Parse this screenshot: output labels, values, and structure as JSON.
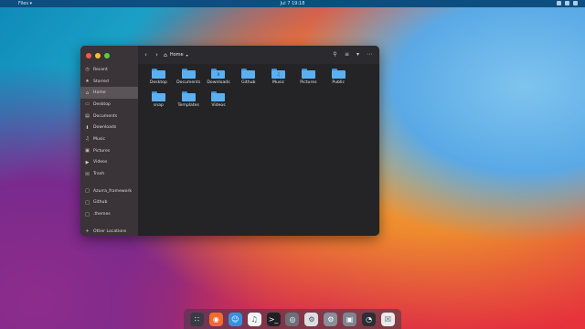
{
  "topbar": {
    "app_menu": "Files ▾",
    "clock": "Jul 7  19:18"
  },
  "window": {
    "sidebar": {
      "items": [
        {
          "label": "Recent",
          "icon": "clock-icon",
          "glyph": "◷"
        },
        {
          "label": "Starred",
          "icon": "star-icon",
          "glyph": "★"
        },
        {
          "label": "Home",
          "icon": "home-icon",
          "glyph": "⌂",
          "active": true
        },
        {
          "label": "Desktop",
          "icon": "desktop-icon",
          "glyph": "▭"
        },
        {
          "label": "Documents",
          "icon": "document-icon",
          "glyph": "▤"
        },
        {
          "label": "Downloads",
          "icon": "download-icon",
          "glyph": "⬇"
        },
        {
          "label": "Music",
          "icon": "music-icon",
          "glyph": "♫"
        },
        {
          "label": "Pictures",
          "icon": "picture-icon",
          "glyph": "▣"
        },
        {
          "label": "Videos",
          "icon": "video-icon",
          "glyph": "▶"
        },
        {
          "label": "Trash",
          "icon": "trash-icon",
          "glyph": "☒"
        }
      ],
      "bookmarks": [
        {
          "label": "Azurra_framework",
          "icon": "folder-icon",
          "glyph": "□"
        },
        {
          "label": "Github",
          "icon": "folder-icon",
          "glyph": "□"
        },
        {
          "label": ".themes",
          "icon": "folder-icon",
          "glyph": "□"
        }
      ],
      "other": {
        "label": "Other Locations",
        "icon": "plus-icon",
        "glyph": "+"
      }
    },
    "header": {
      "location": "Home"
    },
    "folders": [
      {
        "label": "Desktop",
        "glyph": ""
      },
      {
        "label": "Documents",
        "glyph": ""
      },
      {
        "label": "Downloads",
        "glyph": "⬇"
      },
      {
        "label": "Github",
        "glyph": ""
      },
      {
        "label": "Music",
        "glyph": "♫"
      },
      {
        "label": "Pictures",
        "glyph": ""
      },
      {
        "label": "Public",
        "glyph": ""
      },
      {
        "label": "snap",
        "glyph": ""
      },
      {
        "label": "Templates",
        "glyph": ""
      },
      {
        "label": "Videos",
        "glyph": ""
      }
    ]
  },
  "dock": {
    "apps": [
      {
        "name": "app-grid-icon",
        "glyph": "∷",
        "color": "#3a3a46"
      },
      {
        "name": "firefox-icon",
        "glyph": "◉",
        "color": "#f26b2a"
      },
      {
        "name": "files-icon",
        "glyph": "☺",
        "color": "#3b8fe0"
      },
      {
        "name": "music-icon",
        "glyph": "♫",
        "color": "#f5f5f7"
      },
      {
        "name": "terminal-icon",
        "glyph": ">_",
        "color": "#1f1f24"
      },
      {
        "name": "system-monitor-icon",
        "glyph": "◎",
        "color": "#6b6f78"
      },
      {
        "name": "tweaks-icon",
        "glyph": "⚙",
        "color": "#dcdde2"
      },
      {
        "name": "settings-icon",
        "glyph": "⚙",
        "color": "#8a8e98"
      },
      {
        "name": "screenshot-icon",
        "glyph": "▣",
        "color": "#7e8591"
      },
      {
        "name": "disk-usage-icon",
        "glyph": "◔",
        "color": "#2c2f35"
      },
      {
        "name": "trash-icon",
        "glyph": "☒",
        "color": "#e9eaee"
      }
    ]
  }
}
